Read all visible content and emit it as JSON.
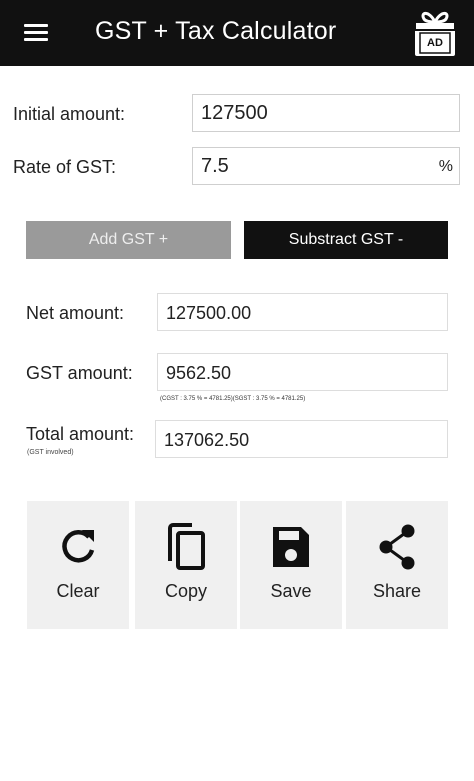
{
  "appbar": {
    "title": "GST + Tax Calculator",
    "menu_icon": "hamburger-menu-icon",
    "ad_icon": "gift-ad-icon",
    "ad_label": "AD"
  },
  "form": {
    "initial_label": "Initial amount:",
    "initial_value": "127500",
    "rate_label": "Rate of GST:",
    "rate_value": "7.5",
    "rate_suffix": "%"
  },
  "buttons": {
    "add_label": "Add GST +",
    "subtract_label": "Substract GST -"
  },
  "results": {
    "net_label": "Net amount:",
    "net_value": "127500.00",
    "gst_label": "GST amount:",
    "gst_value": "9562.50",
    "gst_detail": "(CGST : 3.75 % = 4781.25)(SGST : 3.75 % = 4781.25)",
    "total_label": "Total amount:",
    "total_sublabel": "(GST involved)",
    "total_value": "137062.50"
  },
  "actions": [
    {
      "label": "Clear",
      "icon": "refresh-icon"
    },
    {
      "label": "Copy",
      "icon": "copy-icon"
    },
    {
      "label": "Save",
      "icon": "save-floppy-icon"
    },
    {
      "label": "Share",
      "icon": "share-icon"
    }
  ],
  "colors": {
    "appbar": "#111111",
    "add_button": "#9a9a9a",
    "subtract_button": "#111111",
    "action_tile": "#f0f0f0"
  }
}
